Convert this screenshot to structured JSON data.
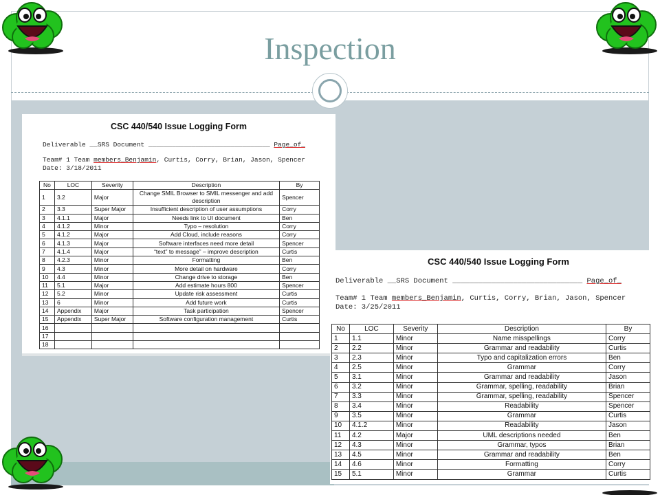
{
  "slide": {
    "title": "Inspection"
  },
  "form1": {
    "title": "CSC 440/540 Issue Logging Form",
    "deliverable_label": "Deliverable __SRS Document _______________________________",
    "page_of": "Page_of_",
    "team_prefix": "Team# 1 Team ",
    "team_members_word": "members_Benjamin",
    "team_suffix": ", Curtis, Corry, Brian, Jason, Spencer",
    "date": "Date: 3/18/2011",
    "headers": [
      "No",
      "LOC",
      "Severity",
      "Description",
      "By"
    ],
    "rows": [
      [
        "1",
        "3.2",
        "Major",
        "Change SMIL Browser to SMIL messenger and add description",
        "Spencer"
      ],
      [
        "2",
        "3.3",
        "Super Major",
        "Insufficient description of user assumptions",
        "Corry"
      ],
      [
        "3",
        "4.1.1",
        "Major",
        "Needs link to UI document",
        "Ben"
      ],
      [
        "4",
        "4.1.2",
        "Minor",
        "Typo – resolution",
        "Corry"
      ],
      [
        "5",
        "4.1.2",
        "Major",
        "Add Cloud, include reasons",
        "Corry"
      ],
      [
        "6",
        "4.1.3",
        "Major",
        "Software interfaces need more detail",
        "Spencer"
      ],
      [
        "7",
        "4.1.4",
        "Major",
        "“text” to message” – improve description",
        "Curtis"
      ],
      [
        "8",
        "4.2.3",
        "Minor",
        "Formatting",
        "Ben"
      ],
      [
        "9",
        "4.3",
        "Minor",
        "More detail on hardware",
        "Corry"
      ],
      [
        "10",
        "4.4",
        "Minor",
        "Change drive to storage",
        "Ben"
      ],
      [
        "11",
        "5.1",
        "Major",
        "Add estimate hours 800",
        "Spencer"
      ],
      [
        "12",
        "5.2",
        "Minor",
        "Update risk assessment",
        "Curtis"
      ],
      [
        "13",
        "6",
        "Minor",
        "Add future work",
        "Curtis"
      ],
      [
        "14",
        "Appendix",
        "Major",
        "Task participation",
        "Spencer"
      ],
      [
        "15",
        "Appendix",
        "Super Major",
        "Software configuration management",
        "Curtis"
      ],
      [
        "16",
        "",
        "",
        "",
        ""
      ],
      [
        "17",
        "",
        "",
        "",
        ""
      ],
      [
        "18",
        "",
        "",
        "",
        ""
      ]
    ]
  },
  "form2": {
    "title": "CSC 440/540 Issue Logging Form",
    "deliverable_label": "Deliverable __SRS Document ______________________________",
    "page_of": "Page_of_",
    "team_prefix": "Team# 1 Team ",
    "team_members_word": "members_Benjamin",
    "team_suffix": ", Curtis, Corry, Brian, Jason, Spencer",
    "date": "Date: 3/25/2011",
    "headers": [
      "No",
      "LOC",
      "Severity",
      "Description",
      "By"
    ],
    "rows": [
      [
        "1",
        "1.1",
        "Minor",
        "Name misspellings",
        "Corry"
      ],
      [
        "2",
        "2.2",
        "Minor",
        "Grammar and readability",
        "Curtis"
      ],
      [
        "3",
        "2.3",
        "Minor",
        "Typo and capitalization errors",
        "Ben"
      ],
      [
        "4",
        "2.5",
        "Minor",
        "Grammar",
        "Corry"
      ],
      [
        "5",
        "3.1",
        "Minor",
        "Grammar and readability",
        "Jason"
      ],
      [
        "6",
        "3.2",
        "Minor",
        "Grammar, spelling, readability",
        "Brian"
      ],
      [
        "7",
        "3.3",
        "Minor",
        "Grammar, spelling, readability",
        "Spencer"
      ],
      [
        "8",
        "3.4",
        "Minor",
        "Readability",
        "Spencer"
      ],
      [
        "9",
        "3.5",
        "Minor",
        "Grammar",
        "Curtis"
      ],
      [
        "10",
        "4.1.2",
        "Minor",
        "Readability",
        "Jason"
      ],
      [
        "11",
        "4.2",
        "Major",
        "UML descriptions needed",
        "Ben"
      ],
      [
        "12",
        "4.3",
        "Minor",
        "Grammar, typos",
        "Brian"
      ],
      [
        "13",
        "4.5",
        "Minor",
        "Grammar and readability",
        "Ben"
      ],
      [
        "14",
        "4.6",
        "Minor",
        "Formatting",
        "Corry"
      ],
      [
        "15",
        "5.1",
        "Minor",
        "Grammar",
        "Curtis"
      ]
    ]
  },
  "icons": {
    "mascot": "smiling-green-cloud-icon"
  },
  "colors": {
    "title": "#7a9ea0",
    "content_bg": "#c5d0d6",
    "cloud_green": "#22c21e"
  }
}
